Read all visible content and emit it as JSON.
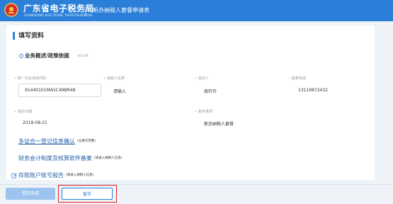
{
  "header": {
    "brand_title": "广东省电子税务局",
    "brand_subtitle": "GUANGDONG ELECTRONIC TAXATION BUREAU",
    "app_name": "新办纳税人套餐申请表"
  },
  "section": {
    "title": "填写资料",
    "subsection_title": "业务概述/政策依据",
    "subsection_hint": "阅读详情"
  },
  "fields": {
    "credit_code": {
      "label": "统一社会信用代码",
      "value": "91440101MA5C49BR48"
    },
    "taxpayer_name": {
      "label": "纳税人名称",
      "value": "请输入"
    },
    "agent": {
      "label": "经办人",
      "value": "周玲玲"
    },
    "phone": {
      "label": "联系电话",
      "value": "13119872432"
    },
    "agent_date": {
      "label": "经办日期",
      "value": "2018-08-21"
    },
    "tax_matter": {
      "label": "税务事项",
      "value": "新办纳税人套餐"
    }
  },
  "links": [
    {
      "label": "多证合一登记信息确认",
      "note": "(已填写完整)"
    },
    {
      "label": "财务会计制度及核算软件备案",
      "note": "(请录入纳税人信息)"
    },
    {
      "label": "存款账户账号报告",
      "note": "(请录入纳税人信息)"
    }
  ],
  "footer": {
    "submit_label": "提交申请",
    "save_label": "暂存"
  },
  "colors": {
    "brand_blue": "#2b7fd9",
    "highlight_red": "#e02020"
  }
}
